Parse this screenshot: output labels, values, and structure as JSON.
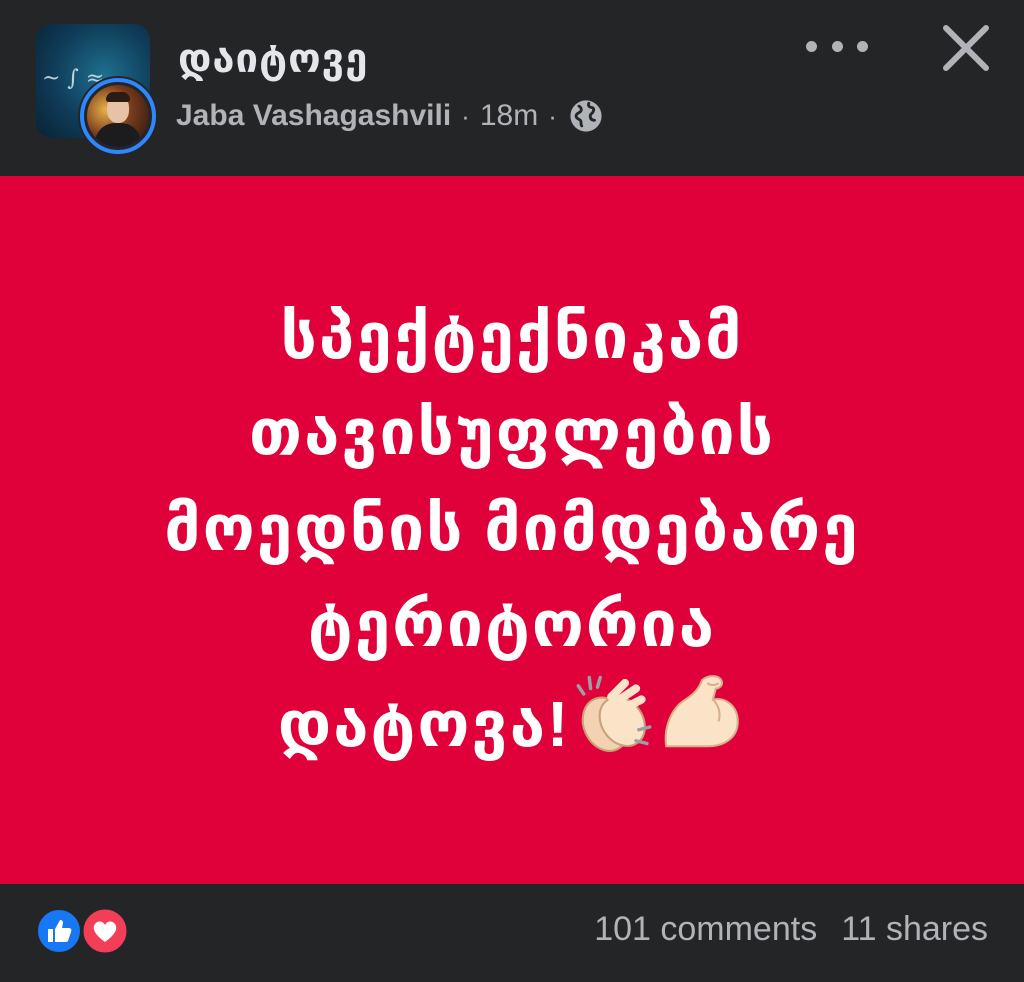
{
  "header": {
    "group_name": "დაიტოვე",
    "author": "Jaba Vashagashvili",
    "separator": "·",
    "time": "18m",
    "privacy_icon": "globe-icon",
    "more_icon": "more-options-icon",
    "close_icon": "close-icon"
  },
  "post": {
    "background_color": "#e0003a",
    "lines": [
      "სპექტექნიკამ",
      "თავისუფლების",
      "მოედნის მიმდებარე",
      "ტერიტორია"
    ],
    "last_line": "დატოვა!",
    "emojis": [
      "clapping-hands-emoji",
      "flexed-biceps-emoji"
    ]
  },
  "footer": {
    "reactions": [
      "like-icon",
      "love-icon"
    ],
    "comments": "101 comments",
    "shares": "11 shares"
  },
  "colors": {
    "background": "#242526",
    "text_secondary": "#b0b3b8",
    "accent_blue": "#2d88ff",
    "love_red": "#f33e58"
  }
}
